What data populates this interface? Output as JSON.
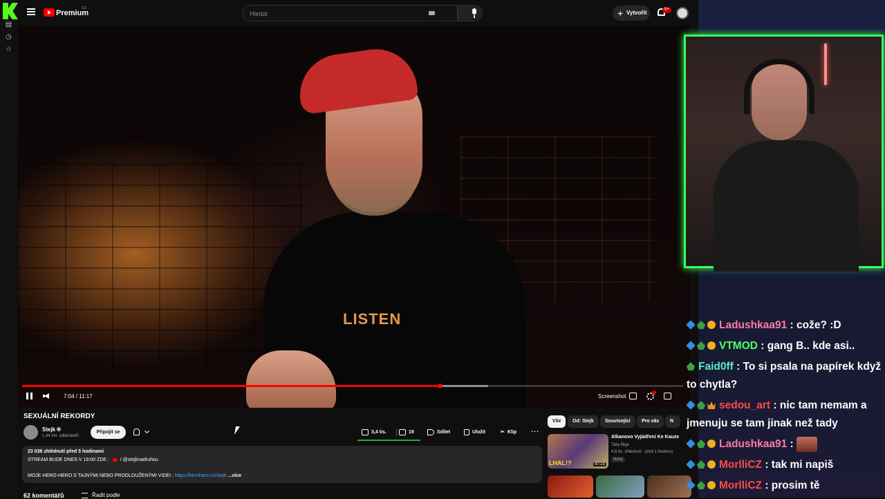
{
  "app": {
    "name": "YouTube",
    "tier_label": "Premium",
    "region": "CZ"
  },
  "colors": {
    "progress": "#ff0000",
    "overlay_border": "#39ff5a",
    "link": "#3ea6ff"
  },
  "header": {
    "search_placeholder": "Hledat",
    "create_label": "Vytvořit",
    "notification_count": "9+"
  },
  "player": {
    "video_text": "LISTEN",
    "time": "7:04 / 11:17",
    "played_fraction": 0.632,
    "buffered_fraction": 0.705,
    "screenshot_label": "Screenshot"
  },
  "video": {
    "title": "SEXUÁLNÍ REKORDY",
    "channel": "Stejk",
    "subscribers": "1,44 mil. odběratelů",
    "join_label": "Připojit se",
    "likes": "3,4 tis.",
    "dislikes": "19",
    "share_label": "Sdílet",
    "save_label": "Uložit",
    "clip_label": "Klip"
  },
  "description": {
    "views_time": "23 036 zhlédnutí  před 5 hodinami",
    "line2_prefix": "STREAM BUDE DNES V 19:00 ZDE :",
    "line2_handle": "/ @stejknadruhou",
    "line3_prefix": "MOJE HERO-HERO S TAJNÝMI NEBO PRODLOUŽENÝMI VIDEI :",
    "line3_url": "https://herohero.co/stejk",
    "more_label": "...více"
  },
  "comments": {
    "count": "62 komentářů",
    "sort_label": "Řadit podle"
  },
  "recommendations": {
    "chips": [
      "Vše",
      "Od: Stejk",
      "Související",
      "Pro vás",
      "N"
    ],
    "first": {
      "thumb_text": "LHAL!?",
      "duration": "47:23",
      "title": "Alkanovo Vyjádření Ke Kauze",
      "channel": "Taky Bige",
      "meta": "4,8 tis. zhlédnutí · před 1 hodinou",
      "badge": "Nový"
    }
  },
  "chat": [
    {
      "user": "Ladushkaa91",
      "color": "#ff7aa8",
      "badges": [
        "a",
        "b",
        "c"
      ],
      "text": ": cože? :D"
    },
    {
      "user": "VTMOD",
      "color": "#52ff6a",
      "badges": [
        "a",
        "b",
        "c"
      ],
      "text": ": gang B.. kde asi.."
    },
    {
      "user": "Faid0ff",
      "color": "#5af0c8",
      "badges": [
        "b"
      ],
      "text": ": To si psala na papírek když to chytla?"
    },
    {
      "user": "sedou_art",
      "color": "#ff4a4a",
      "badges": [
        "a",
        "b",
        "d"
      ],
      "text": ": nic tam nemam a jmenuju se tam jinak než tady"
    },
    {
      "user": "Ladushkaa91",
      "color": "#ff7aa8",
      "badges": [
        "a",
        "b",
        "c"
      ],
      "text": ":",
      "emote": true
    },
    {
      "user": "MorlliCZ",
      "color": "#ff4a4a",
      "badges": [
        "a",
        "b",
        "c"
      ],
      "text": ": tak mi napiš"
    },
    {
      "user": "MorlliCZ",
      "color": "#ff4a4a",
      "badges": [
        "a",
        "b",
        "c"
      ],
      "text": ": prosim tě"
    }
  ]
}
